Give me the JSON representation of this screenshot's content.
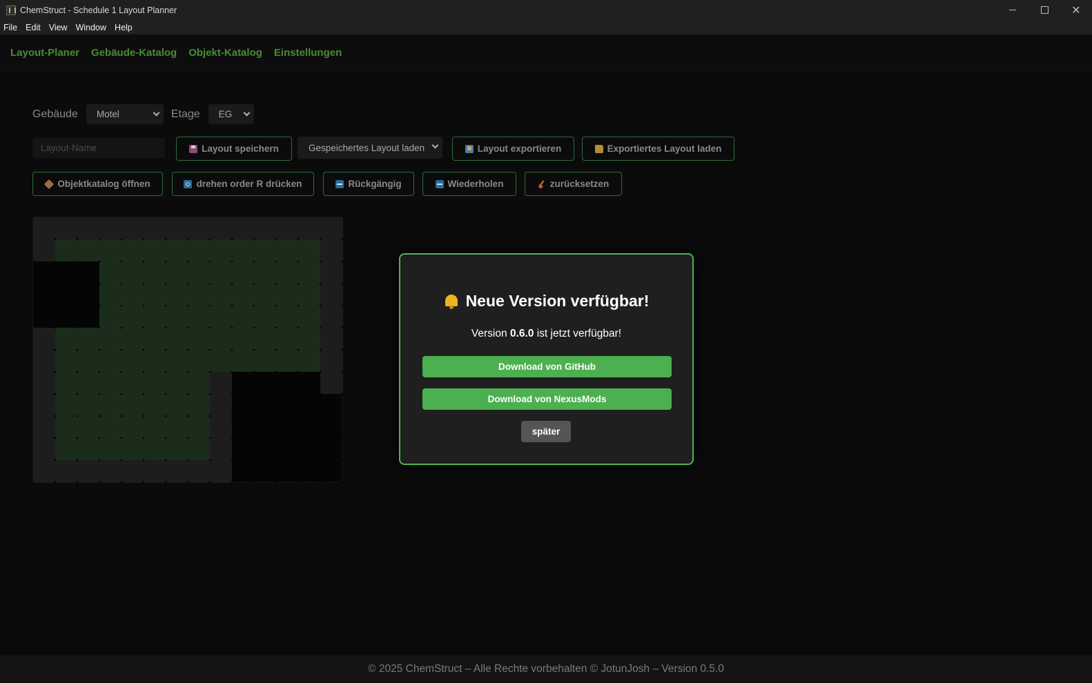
{
  "window": {
    "title": "ChemStruct - Schedule 1 Layout Planner",
    "controls": {
      "minimize": "",
      "maximize": "",
      "close": "✕"
    }
  },
  "menubar": {
    "items": [
      "File",
      "Edit",
      "View",
      "Window",
      "Help"
    ]
  },
  "nav": {
    "items": [
      "Layout-Planer",
      "Gebäude-Katalog",
      "Objekt-Katalog",
      "Einstellungen"
    ]
  },
  "toolbar": {
    "building_label": "Gebäude",
    "building_value": "Motel",
    "floor_label": "Etage",
    "floor_value": "EG",
    "layout_name_placeholder": "Layout-Name",
    "save_label": "Layout speichern",
    "load_saved_value": "Gespeichertes Layout laden",
    "export_label": "Layout exportieren",
    "load_export_label": "Exportiertes Layout laden",
    "open_catalog_label": "Objektkatalog öffnen",
    "rotate_label": "drehen order R drücken",
    "undo_label": "Rückgängig",
    "redo_label": "Wiederholen",
    "reset_label": "zurücksetzen"
  },
  "icons": {
    "save": "floppy-disk-icon",
    "export": "export-icon",
    "load_export": "folder-icon",
    "catalog": "package-icon",
    "rotate": "rotate-icon",
    "undo": "arrow-left-icon",
    "redo": "arrow-right-icon",
    "reset": "broom-icon",
    "modal": "bell-icon"
  },
  "modal": {
    "title": "Neue Version verfügbar!",
    "version_prefix": "Version",
    "version": "0.6.0",
    "version_suffix": "ist jetzt verfügbar!",
    "github_label": "Download von GitHub",
    "nexus_label": "Download von NexusMods",
    "later_label": "später"
  },
  "footer": {
    "text": "© 2025 ChemStruct – Alle Rechte vorbehalten © JotunJosh – Version 0.5.0"
  },
  "colors": {
    "accent_green": "#4caf50",
    "nav_green": "#4a8a3a",
    "border_green": "#2f6d3b",
    "floor_green": "#1b2c1b",
    "wall_gray": "#1d1d1d",
    "background": "#0a0a0a"
  }
}
